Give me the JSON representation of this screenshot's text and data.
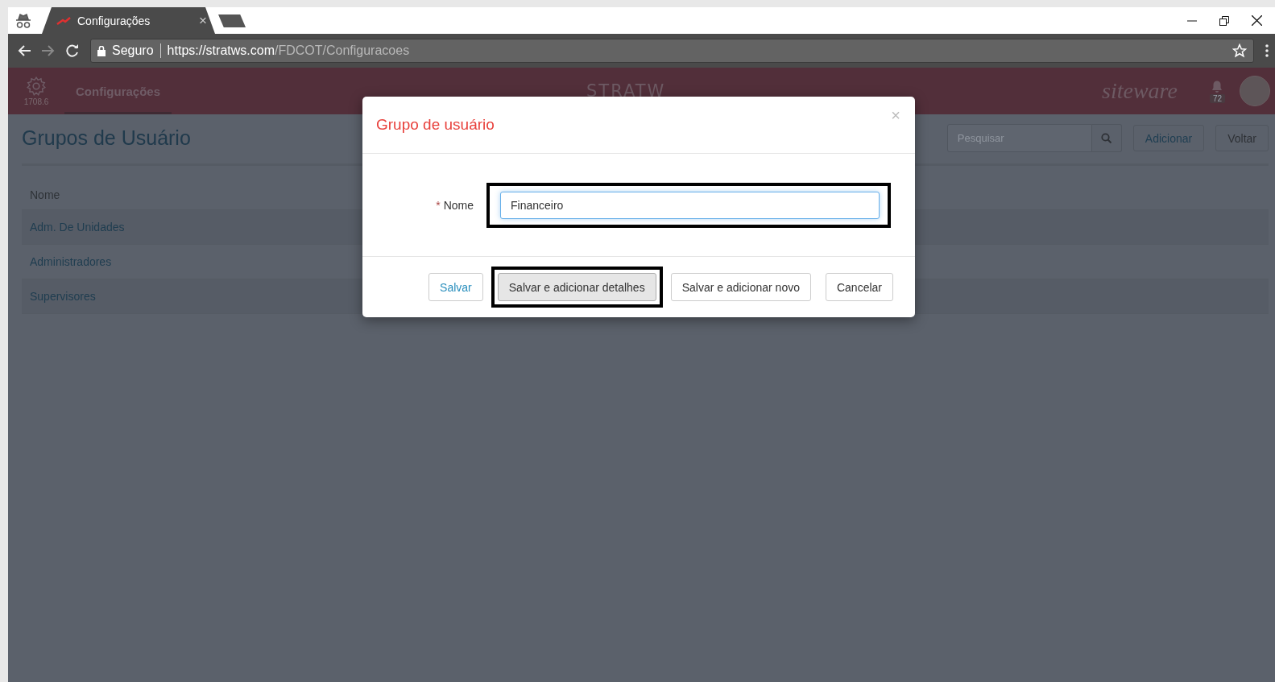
{
  "browser": {
    "tabs": [
      {
        "title": "Configurações",
        "close": "×",
        "selected": true
      }
    ],
    "address": {
      "security": "Seguro",
      "host": "https://stratws.com",
      "path": "/FDCOT/Configuracoes"
    }
  },
  "app_header": {
    "version": "1708.6",
    "nav": [
      {
        "label": "Configurações",
        "selected": true
      }
    ],
    "logo_left": "STRATW",
    "logo_right": "siteware",
    "notifications": "72"
  },
  "page": {
    "title": "Grupos de Usuário",
    "search": {
      "placeholder": "Pesquisar"
    },
    "actions": [
      {
        "label": "Adicionar",
        "kind": "primary"
      },
      {
        "label": "Voltar",
        "kind": "default"
      }
    ],
    "table": {
      "columns": [
        "Nome"
      ],
      "rows": [
        [
          "Adm. De Unidades"
        ],
        [
          "Administradores"
        ],
        [
          "Supervisores"
        ]
      ]
    }
  },
  "modal": {
    "title": "Grupo de usuário",
    "close": "×",
    "fields": [
      {
        "label": "Nome",
        "required": true,
        "required_mark": "*",
        "value": "Financeiro",
        "focused": true,
        "annotated": true
      }
    ],
    "buttons": [
      {
        "label": "Salvar",
        "kind": "link",
        "annotated": false
      },
      {
        "label": "Salvar e adicionar detalhes",
        "kind": "pressed",
        "annotated": true
      },
      {
        "label": "Salvar e adicionar novo",
        "kind": "default",
        "annotated": false
      },
      {
        "label": "Cancelar",
        "kind": "default",
        "annotated": false
      }
    ]
  }
}
